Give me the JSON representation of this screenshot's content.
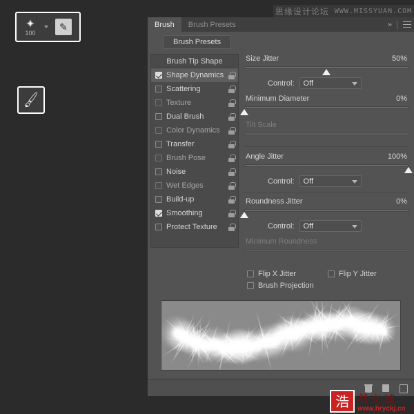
{
  "watermark_top": {
    "cn": "思缘设计论坛",
    "url": "WWW.MISSYUAN.COM"
  },
  "watermark_bottom": {
    "logo_char": "浩",
    "cn": "然义诚",
    "url": "www.hryckj.cn"
  },
  "tool_options": {
    "brush_size": "100",
    "chevron_icon": "chevron-down-icon",
    "tablet_pressure_icon": "tablet-pressure-icon"
  },
  "toolbox": {
    "active_tool_icon": "brush-tool-icon",
    "active_tool_glyph": "🖌"
  },
  "panel": {
    "tabs": [
      {
        "label": "Brush",
        "active": true
      },
      {
        "label": "Brush Presets",
        "active": false
      }
    ],
    "expand_icon": "»",
    "menu_icon": "panel-menu-icon",
    "presets_button": "Brush Presets",
    "option_list_header": "Brush Tip Shape",
    "options": [
      {
        "label": "Shape Dynamics",
        "checked": true,
        "selected": true,
        "dim": false
      },
      {
        "label": "Scattering",
        "checked": false,
        "selected": false,
        "dim": false
      },
      {
        "label": "Texture",
        "checked": false,
        "selected": false,
        "dim": true
      },
      {
        "label": "Dual Brush",
        "checked": false,
        "selected": false,
        "dim": false
      },
      {
        "label": "Color Dynamics",
        "checked": false,
        "selected": false,
        "dim": true
      },
      {
        "label": "Transfer",
        "checked": false,
        "selected": false,
        "dim": false
      },
      {
        "label": "Brush Pose",
        "checked": false,
        "selected": false,
        "dim": true
      },
      {
        "label": "Noise",
        "checked": false,
        "selected": false,
        "dim": false
      },
      {
        "label": "Wet Edges",
        "checked": false,
        "selected": false,
        "dim": true
      },
      {
        "label": "Build-up",
        "checked": false,
        "selected": false,
        "dim": false
      },
      {
        "label": "Smoothing",
        "checked": true,
        "selected": false,
        "dim": false
      },
      {
        "label": "Protect Texture",
        "checked": false,
        "selected": false,
        "dim": false
      }
    ],
    "controls": {
      "size_jitter": {
        "label": "Size Jitter",
        "value": "50%",
        "pos": 50,
        "disabled": false
      },
      "size_control": {
        "label": "Control:",
        "value": "Off"
      },
      "minimum_diameter": {
        "label": "Minimum Diameter",
        "value": "0%",
        "pos": 0,
        "disabled": false
      },
      "tilt_scale": {
        "label": "Tilt Scale",
        "value": "",
        "pos": 0,
        "disabled": true
      },
      "angle_jitter": {
        "label": "Angle Jitter",
        "value": "100%",
        "pos": 100,
        "disabled": false
      },
      "angle_control": {
        "label": "Control:",
        "value": "Off"
      },
      "roundness_jitter": {
        "label": "Roundness Jitter",
        "value": "0%",
        "pos": 0,
        "disabled": false
      },
      "roundness_control": {
        "label": "Control:",
        "value": "Off"
      },
      "minimum_roundness": {
        "label": "Minimum Roundness",
        "value": "",
        "pos": 100,
        "disabled": true
      }
    },
    "checkboxes": [
      {
        "label": "Flip X Jitter",
        "checked": false
      },
      {
        "label": "Flip Y Jitter",
        "checked": false
      },
      {
        "label": "Brush Projection",
        "checked": false
      }
    ],
    "preview_alt": "brush-stroke-preview",
    "footer_icons": [
      "trash-icon",
      "page-icon",
      "new-brush-icon"
    ]
  }
}
